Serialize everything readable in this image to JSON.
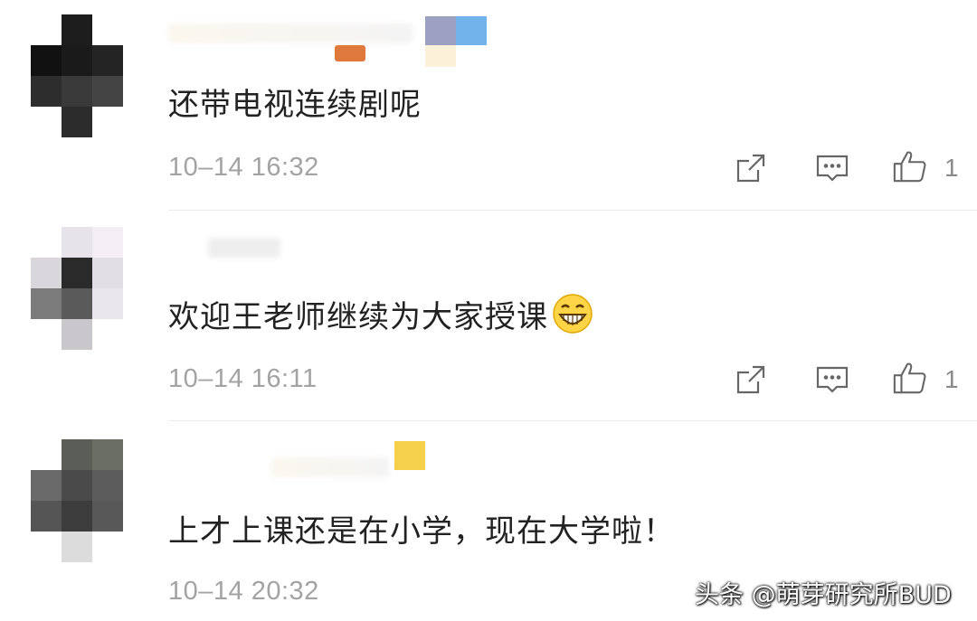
{
  "comments": [
    {
      "text": "还带电视连续剧呢",
      "time": "10–14 16:32",
      "likes": "1"
    },
    {
      "text": "欢迎王老师继续为大家授课",
      "time": "10–14 16:11",
      "likes": "1",
      "emoji": "grinning-face-icon"
    },
    {
      "text": "上才上课还是在小学，现在大学啦！",
      "time": "10–14 20:32"
    }
  ],
  "watermark": "头条 @萌芽研究所BUD",
  "colors": {
    "text": "#222222",
    "meta": "#a3a3a3",
    "divider": "#ececec"
  }
}
